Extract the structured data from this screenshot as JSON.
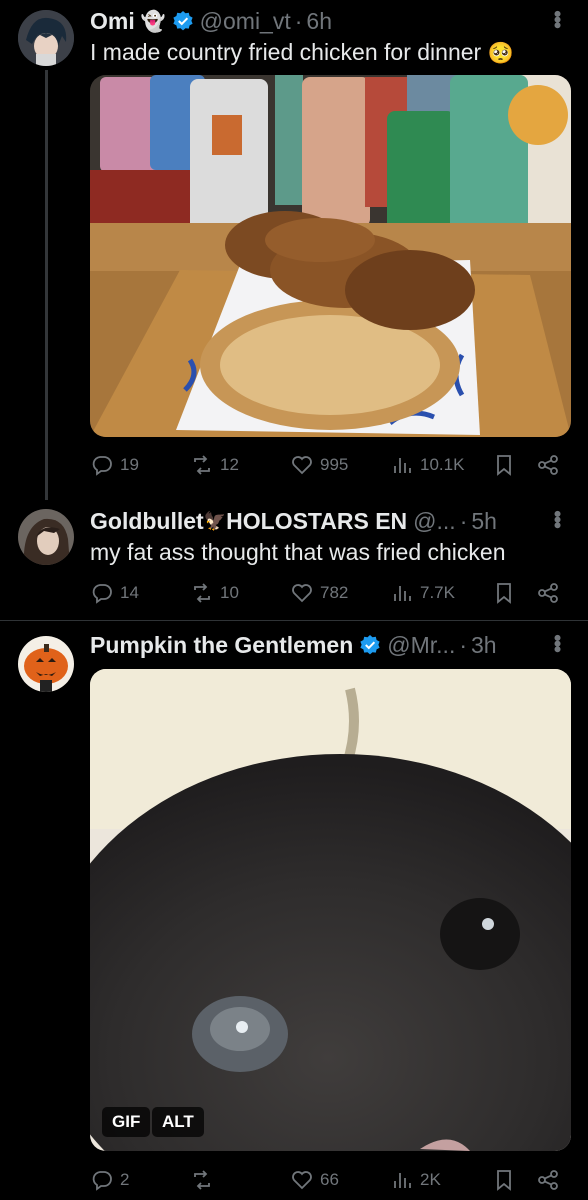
{
  "posts": [
    {
      "name": "Omi",
      "name_emoji": "👻",
      "handle": "@omi_vt",
      "time": "6h",
      "text": "I made country fried chicken for dinner",
      "text_emoji": "🥺",
      "media": "photo of country fried chicken and hash browns on a plate with cans in background",
      "replies": "19",
      "reposts": "12",
      "likes": "995",
      "views": "10.1K"
    },
    {
      "name": "Goldbullet",
      "name_symbol": "🦅",
      "name_suffix": "HOLOSTARS EN",
      "handle": "@...",
      "time": "5h",
      "text": "my fat ass thought that was fried chicken",
      "replies": "14",
      "reposts": "10",
      "likes": "782",
      "views": "7.7K"
    },
    {
      "name": "Pumpkin the Gentlemen",
      "handle": "@Mr...",
      "time": "3h",
      "gif_label": "GIF",
      "alt_label": "ALT",
      "replies": "2",
      "reposts": "",
      "likes": "66",
      "views": "2K"
    }
  ],
  "colors": {
    "verified": "#1d9bf0",
    "muted": "#71767b",
    "text": "#e7e9ea",
    "background": "#000000"
  }
}
